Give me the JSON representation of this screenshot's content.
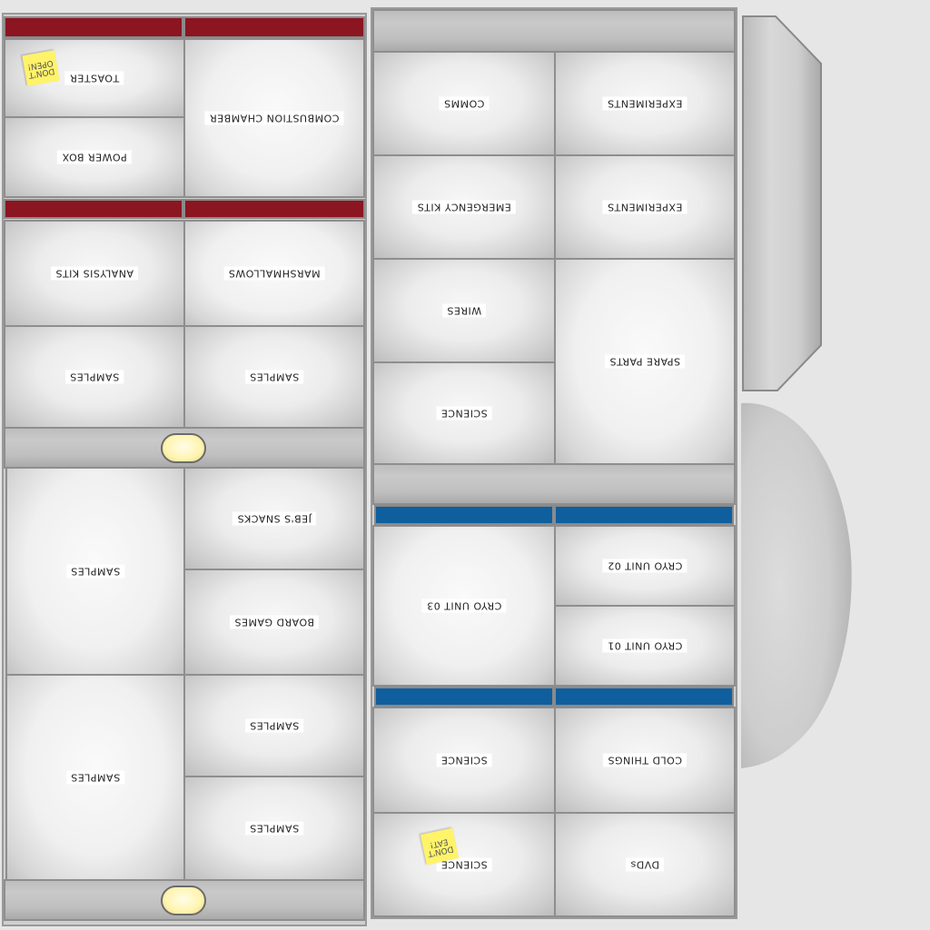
{
  "colors": {
    "red_stripe": "#8b1520",
    "blue_stripe": "#0f5f9e",
    "sticky_note": "#fff36a"
  },
  "left_top": {
    "toaster": "TOASTER",
    "power_box": "POWER BOX",
    "combustion_chamber": "COMBUSTION CHAMBER",
    "note": "DON'T OPEN!"
  },
  "left_mid": {
    "analysis_kits": "ANALYSIS KITS",
    "marshmallows": "MARSHMALLOWS",
    "samples_a": "SAMPLES",
    "samples_b": "SAMPLES"
  },
  "left_bottom": {
    "samples_tall_1": "SAMPLES",
    "jebs_snacks": "JEB'S SNACKS",
    "board_games": "BOARD GAMES",
    "samples_tall_2": "SAMPLES",
    "samples_c": "SAMPLES",
    "samples_d": "SAMPLES"
  },
  "right_top": {
    "comms": "COMMS",
    "experiments_1": "EXPERIMENTS",
    "emergency_kits": "EMERGENCY KITS",
    "experiments_2": "EXPERIMENTS",
    "wires": "WIRES",
    "spare_parts": "SPARE PARTS",
    "science": "SCIENCE"
  },
  "right_mid": {
    "cryo_03": "CRYO UNIT 03",
    "cryo_02": "CRYO UNIT 02",
    "cryo_01": "CRYO UNIT 01"
  },
  "right_bottom": {
    "science_1": "SCIENCE",
    "cold_things": "COLD THINGS",
    "science_2": "SCIENCE",
    "dvds": "DVDs",
    "note": "DON'T EAT!"
  }
}
